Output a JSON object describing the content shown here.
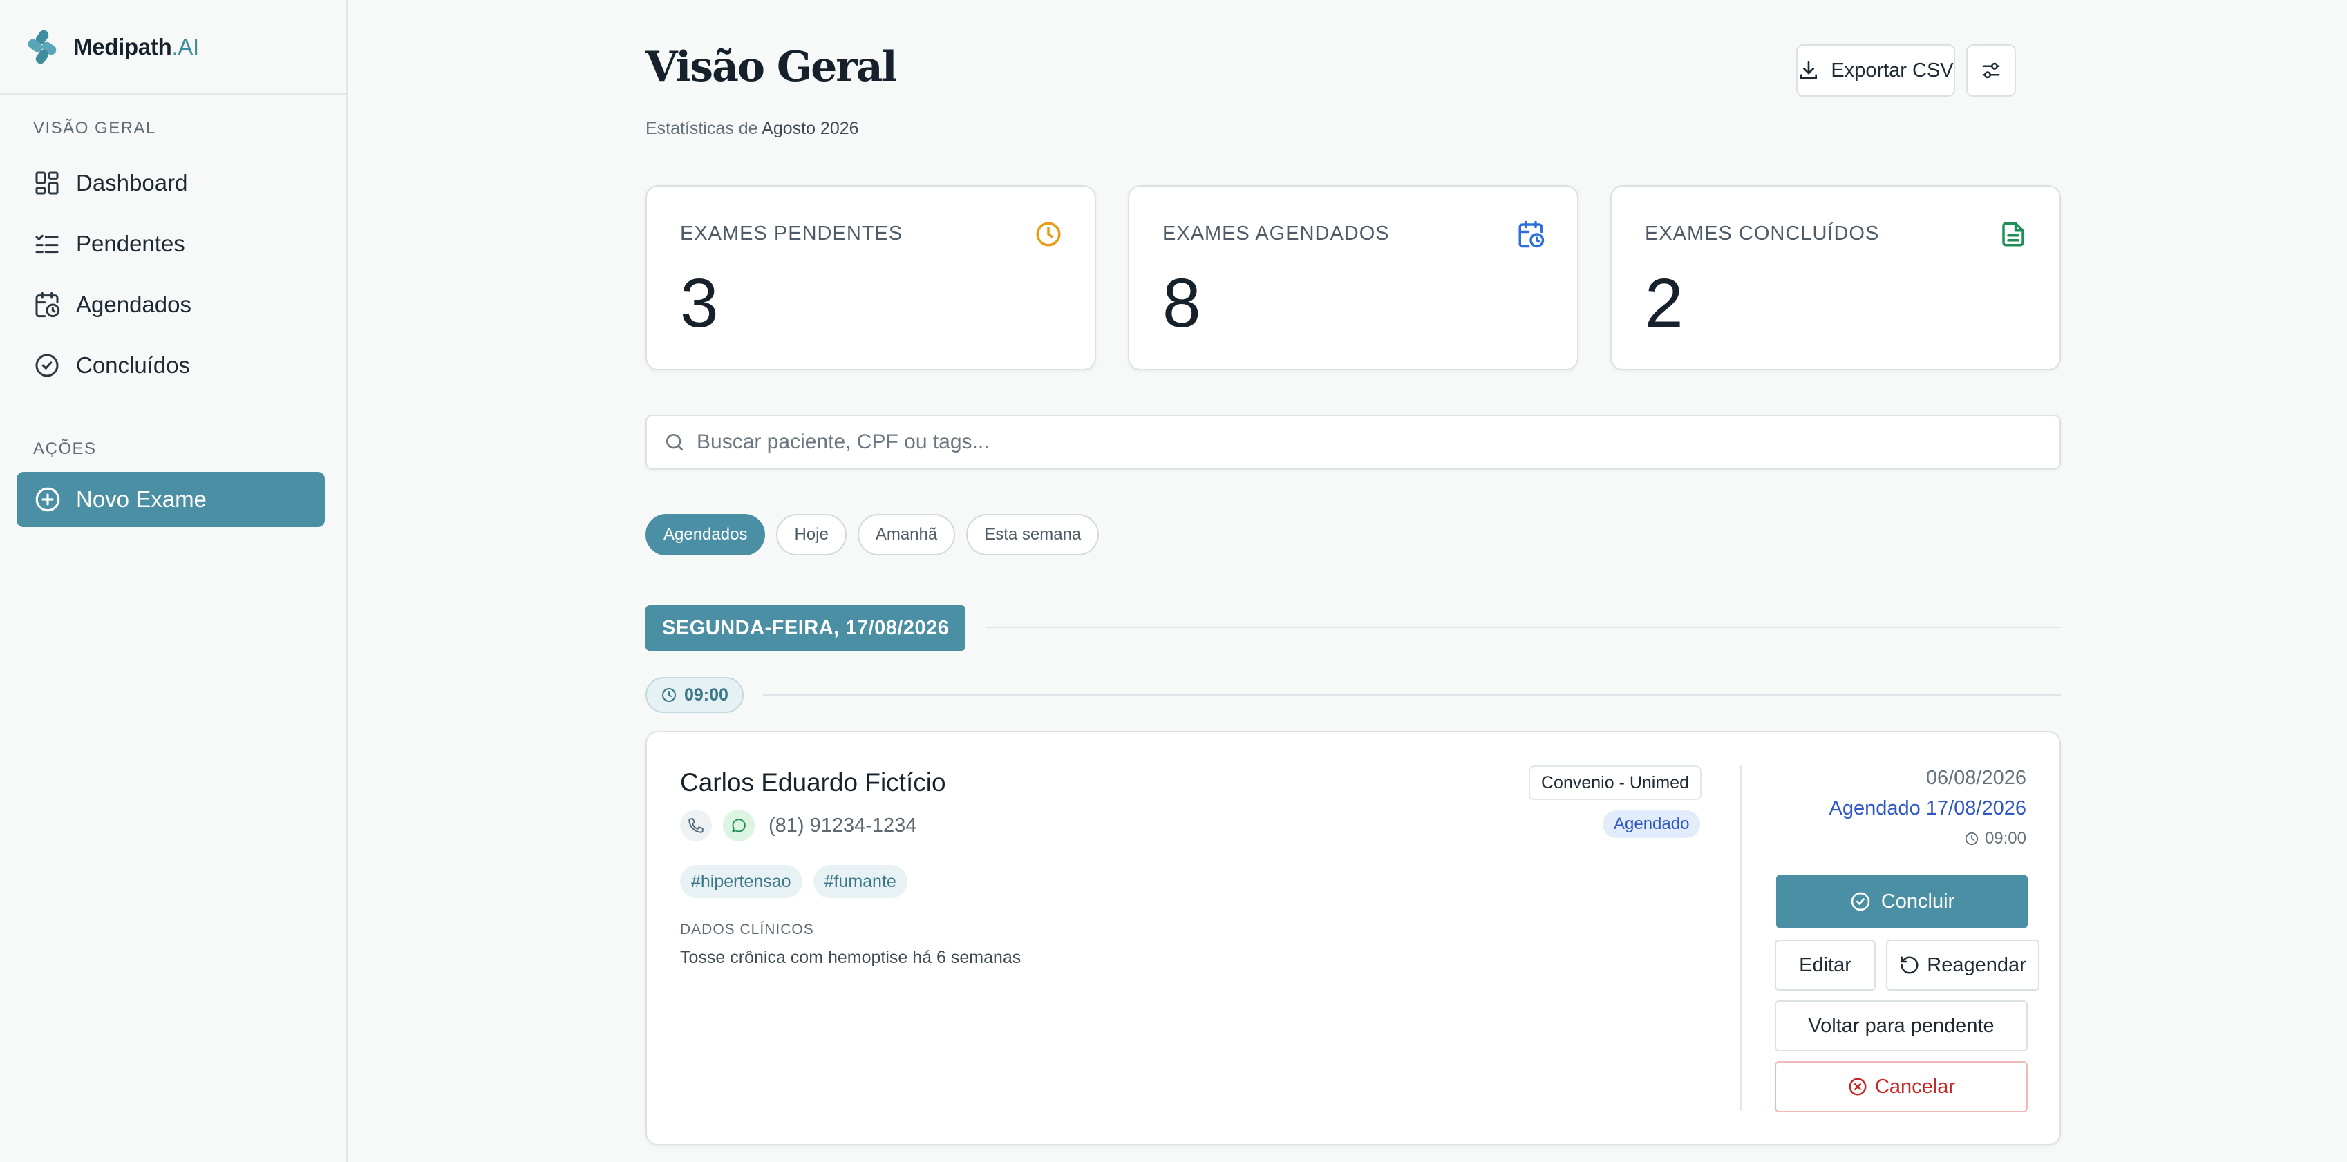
{
  "brand": {
    "name": "Medipath",
    "suffix": ".AI"
  },
  "sidebar": {
    "overview_label": "VISÃO GERAL",
    "items": [
      {
        "label": "Dashboard",
        "icon": "dashboard-icon"
      },
      {
        "label": "Pendentes",
        "icon": "list-checks-icon"
      },
      {
        "label": "Agendados",
        "icon": "calendar-clock-icon"
      },
      {
        "label": "Concluídos",
        "icon": "check-circle-icon"
      }
    ],
    "actions_label": "AÇÕES",
    "new_exam_label": "Novo Exame"
  },
  "header": {
    "title": "Visão Geral",
    "subtitle_prefix": "Estatísticas de",
    "subtitle_month": "Agosto 2026",
    "export_label": "Exportar CSV"
  },
  "stats": [
    {
      "label": "EXAMES PENDENTES",
      "value": "3",
      "color": "#e89b14"
    },
    {
      "label": "EXAMES AGENDADOS",
      "value": "8",
      "color": "#2f6fdb"
    },
    {
      "label": "EXAMES CONCLUÍDOS",
      "value": "2",
      "color": "#1f8f57"
    }
  ],
  "search": {
    "placeholder": "Buscar paciente, CPF ou tags..."
  },
  "filters": [
    "Agendados",
    "Hoje",
    "Amanhã",
    "Esta semana"
  ],
  "schedule": {
    "date_header": "SEGUNDA-FEIRA, 17/08/2026",
    "time_slot": "09:00",
    "exam": {
      "patient": "Carlos Eduardo Fictício",
      "phone": "(81) 91234-1234",
      "tags": [
        "#hipertensao",
        "#fumante"
      ],
      "clinical_label": "DADOS CLÍNICOS",
      "clinical_text": "Tosse crônica com hemoptise há 6 semanas",
      "insurance": "Convenio - Unimed",
      "status": "Agendado",
      "created_date": "06/08/2026",
      "scheduled": "Agendado 17/08/2026",
      "scheduled_time": "09:00",
      "actions": {
        "conclude": "Concluir",
        "edit": "Editar",
        "reschedule": "Reagendar",
        "back_to_pending": "Voltar para pendente",
        "cancel": "Cancelar"
      }
    }
  },
  "colors": {
    "accent": "#4a8fa3",
    "danger": "#c62828",
    "info": "#2f58c4"
  }
}
